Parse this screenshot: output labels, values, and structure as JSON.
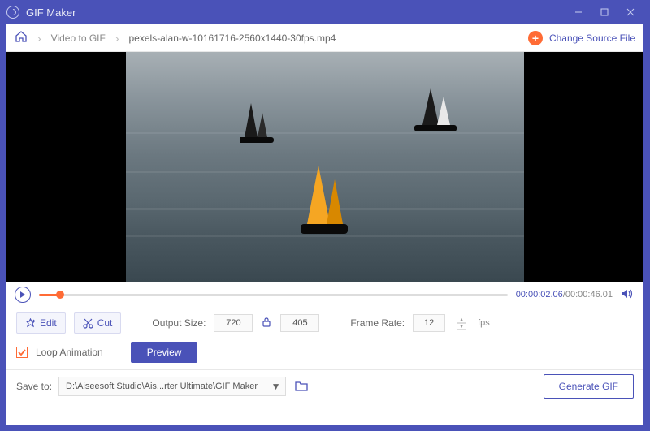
{
  "app": {
    "title": "GIF Maker"
  },
  "window": {
    "minimize": "—",
    "maximize": "□",
    "close": "×"
  },
  "breadcrumb": {
    "item1": "Video to GIF",
    "item2": "pexels-alan-w-10161716-2560x1440-30fps.mp4"
  },
  "toolbar": {
    "change_source": "Change Source File"
  },
  "playback": {
    "current_time": "00:00:02.06",
    "total_time": "00:00:46.01",
    "sep": "/"
  },
  "controls": {
    "edit_label": "Edit",
    "cut_label": "Cut",
    "output_size_label": "Output Size:",
    "width": "720",
    "height": "405",
    "frame_rate_label": "Frame Rate:",
    "frame_rate": "12",
    "fps_label": "fps",
    "loop_label": "Loop Animation",
    "preview_label": "Preview"
  },
  "footer": {
    "save_label": "Save to:",
    "save_path": "D:\\Aiseesoft Studio\\Ais...rter Ultimate\\GIF Maker",
    "generate_label": "Generate GIF"
  }
}
